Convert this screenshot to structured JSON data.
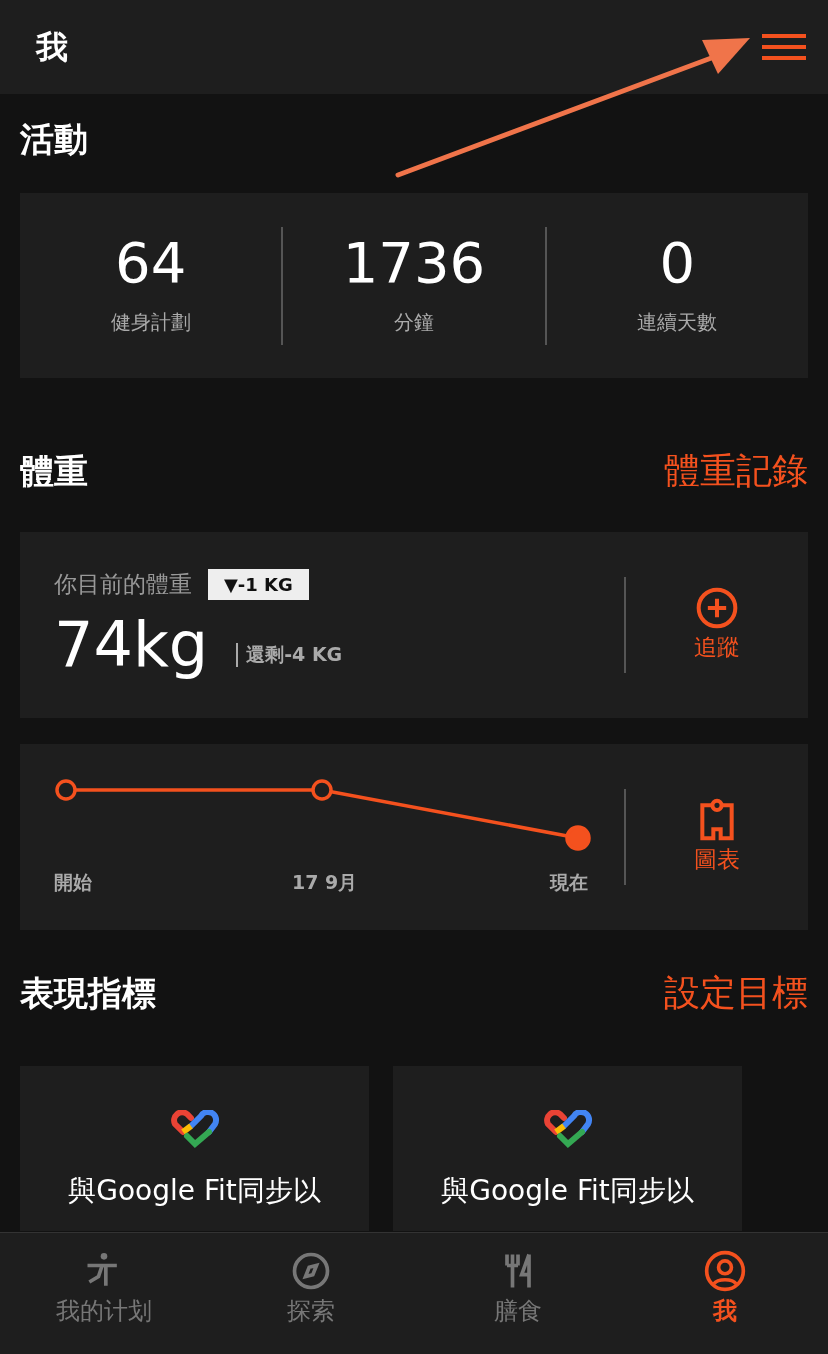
{
  "header": {
    "title": "我"
  },
  "activity": {
    "title": "活動",
    "stats": [
      {
        "value": "64",
        "label": "健身計劃"
      },
      {
        "value": "1736",
        "label": "分鐘"
      },
      {
        "value": "0",
        "label": "連續天數"
      }
    ]
  },
  "weight": {
    "title": "體重",
    "link": "體重記錄",
    "current_label": "你目前的體重",
    "change_badge": "▼-1 KG",
    "value": "74kg",
    "remaining": "還剩-4 KG",
    "track_label": "追蹤"
  },
  "trend": {
    "points": [
      {
        "label": "開始",
        "filled": false
      },
      {
        "label": "17 9月",
        "filled": false
      },
      {
        "label": "現在",
        "filled": true
      }
    ],
    "chart_label": "圖表"
  },
  "metrics": {
    "title": "表現指標",
    "link": "設定目標",
    "cards": [
      {
        "text": "與Google Fit同步以"
      },
      {
        "text": "與Google Fit同步以"
      }
    ]
  },
  "nav": [
    {
      "kind": "plan",
      "label": "我的计划",
      "selected": false
    },
    {
      "kind": "explore",
      "label": "探索",
      "selected": false
    },
    {
      "kind": "diet",
      "label": "膳食",
      "selected": false
    },
    {
      "kind": "me",
      "label": "我",
      "selected": true
    }
  ]
}
